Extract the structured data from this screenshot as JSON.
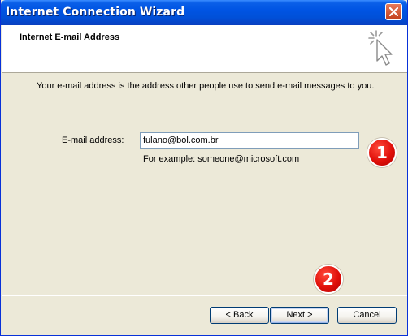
{
  "window": {
    "title": "Internet Connection Wizard"
  },
  "header": {
    "title": "Internet E-mail Address"
  },
  "main": {
    "intro": "Your e-mail address is the address other people use to send e-mail messages to you.",
    "email_label": "E-mail address:",
    "email_value": "fulano@bol.com.br",
    "example": "For example: someone@microsoft.com"
  },
  "annotations": {
    "badge1": "1",
    "badge2": "2",
    "badge_color": "#e0100a"
  },
  "buttons": {
    "back": "< Back",
    "next": "Next >",
    "cancel": "Cancel"
  },
  "icons": {
    "close": "close-icon",
    "wizard": "wizard-cursor-icon"
  },
  "colors": {
    "titlebar": "#0054e3",
    "dialog_bg": "#ece9d8"
  }
}
